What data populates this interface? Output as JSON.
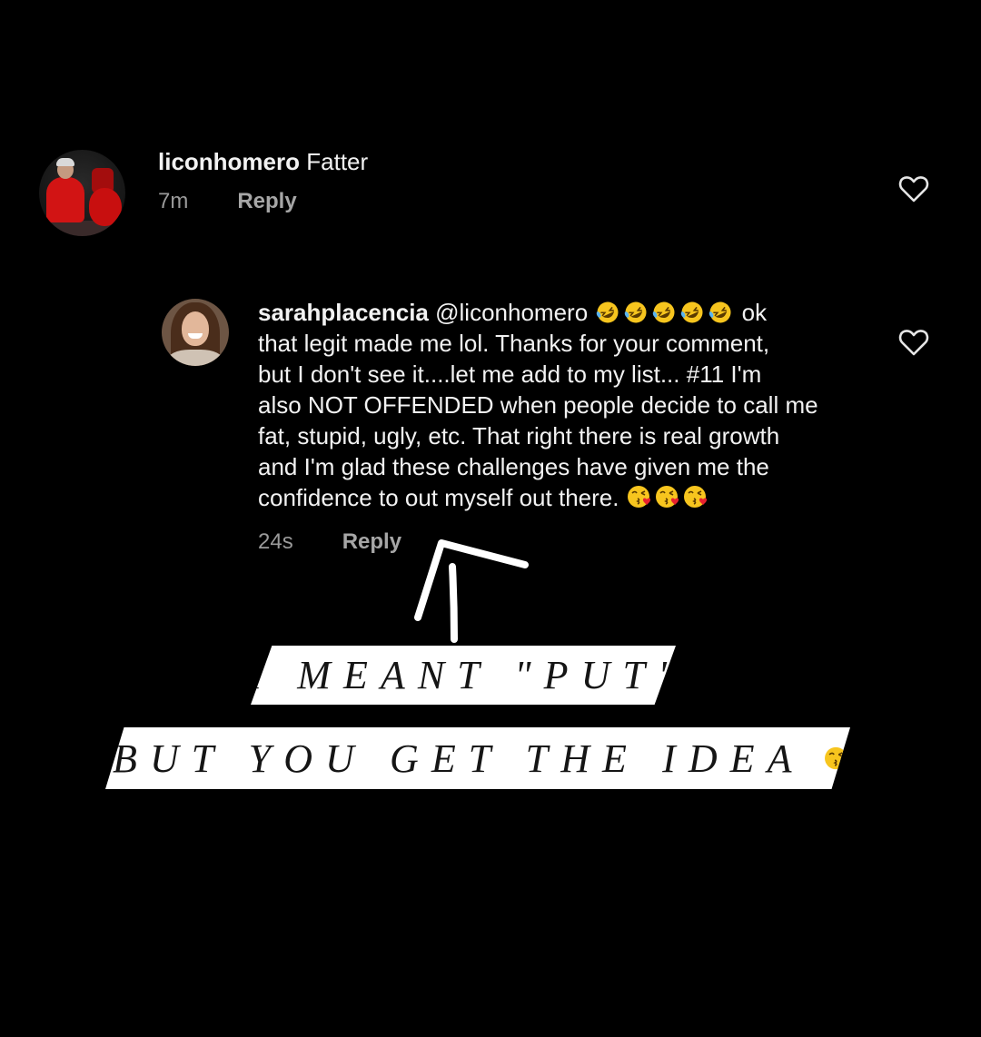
{
  "comments": [
    {
      "username": "liconhomero",
      "text": "Fatter",
      "time": "7m",
      "reply_label": "Reply"
    },
    {
      "username": "sarahplacencia",
      "mention": "@liconhomero",
      "line1_tail": "ok",
      "lines": [
        "that legit made me lol. Thanks for your comment,",
        "but I don't see it....let me add to my list... #11 I'm",
        "also NOT OFFENDED when people decide to call me",
        "fat, stupid, ugly, etc. That right there is real growth",
        "and I'm glad these challenges have given me the"
      ],
      "last_line": "confidence to out myself out there.",
      "time": "24s",
      "reply_label": "Reply"
    }
  ],
  "overlay": {
    "line1": "I MEANT \"PUT\"",
    "line2": "BUT YOU GET THE IDEA"
  },
  "icons": {
    "heart": "heart-outline-icon",
    "laughing_emoji": "rolling-on-floor-laughing-emoji",
    "kiss_emoji": "face-blowing-kiss-emoji"
  },
  "colors": {
    "background": "#000000",
    "text": "#f2f2f2",
    "meta": "#9a9a9a",
    "banner": "#ffffff",
    "banner_text": "#151515"
  }
}
